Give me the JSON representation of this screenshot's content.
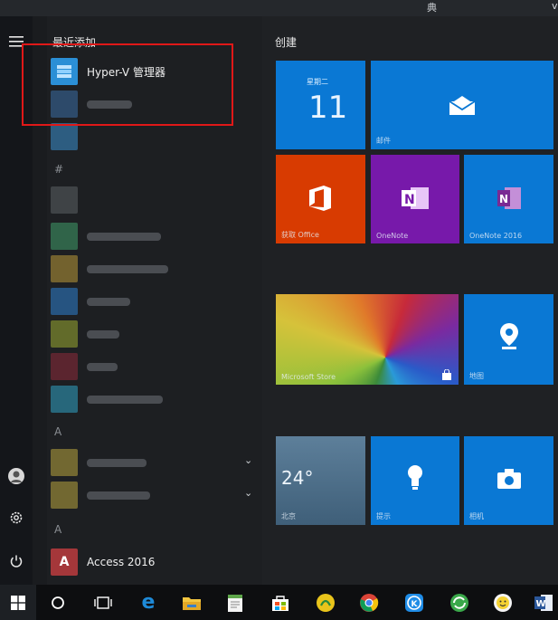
{
  "top_strip": {
    "text_a": "典",
    "text_b": "v"
  },
  "recent": {
    "title": "最近添加",
    "apps": [
      {
        "label": "Hyper-V 管理器"
      }
    ],
    "all_apps_bottom": {
      "label": "Access 2016"
    }
  },
  "tiles_group": {
    "title": "创建"
  },
  "tiles": {
    "calendar": {
      "weekday": "星期二",
      "day": "11"
    },
    "mail": {
      "label": "邮件"
    },
    "office": {
      "label": "获取 Office"
    },
    "onenote": {
      "label": "OneNote"
    },
    "onenote2016": {
      "label": "OneNote 2016"
    },
    "store": {
      "label": "Microsoft Store"
    },
    "maps": {
      "label": "地图"
    },
    "weather": {
      "temp": "24°",
      "label": "北京"
    },
    "tips": {
      "label": "提示"
    },
    "camera": {
      "label": "相机"
    }
  },
  "colors": {
    "accent": "#0078d7",
    "office": "#d83b01",
    "onenote": "#7719aa",
    "highlight": "#e01818"
  }
}
